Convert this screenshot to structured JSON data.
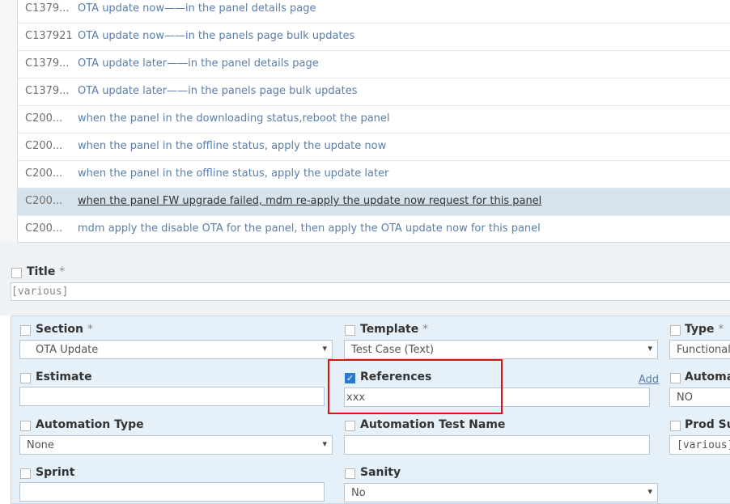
{
  "rows": [
    {
      "id": "C1379...",
      "title": "OTA update now——in the panel details page"
    },
    {
      "id": "C137921",
      "title": "OTA update now——in the panels page bulk updates"
    },
    {
      "id": "C1379...",
      "title": "OTA update later——in the panel details page"
    },
    {
      "id": "C1379...",
      "title": "OTA update later——in the panels page bulk updates"
    },
    {
      "id": "C200...",
      "title": "when the panel in the downloading status,reboot the panel"
    },
    {
      "id": "C200...",
      "title": "when the panel in the offline status, apply the update now"
    },
    {
      "id": "C200...",
      "title": "when the panel in the offline status, apply the update later"
    },
    {
      "id": "C200...",
      "title": "when the panel FW upgrade failed, mdm re-apply the update now request for this panel"
    },
    {
      "id": "C200...",
      "title": "mdm apply the disable OTA for the panel, then apply the OTA update now for this panel"
    }
  ],
  "title_field": {
    "label": "Title",
    "required": "*",
    "value": "[various]"
  },
  "fields": {
    "section": {
      "label": "Section",
      "required": "*",
      "value": "OTA Update"
    },
    "template": {
      "label": "Template",
      "required": "*",
      "value": "Test Case (Text)"
    },
    "type": {
      "label": "Type",
      "required": "*",
      "value": "Functional"
    },
    "estimate": {
      "label": "Estimate",
      "value": ""
    },
    "references": {
      "label": "References",
      "value": "xxx",
      "add_link": "Add",
      "checked": "✓"
    },
    "automated": {
      "label": "Automate",
      "value": "NO"
    },
    "automation_type": {
      "label": "Automation Type",
      "value": "None"
    },
    "automation_test_name": {
      "label": "Automation Test Name",
      "value": ""
    },
    "prod_support": {
      "label": "Prod Sup",
      "value": "[various]"
    },
    "sprint": {
      "label": "Sprint",
      "value": ""
    },
    "sanity": {
      "label": "Sanity",
      "value": "No"
    }
  },
  "icons": {
    "dropdown": "▾"
  }
}
